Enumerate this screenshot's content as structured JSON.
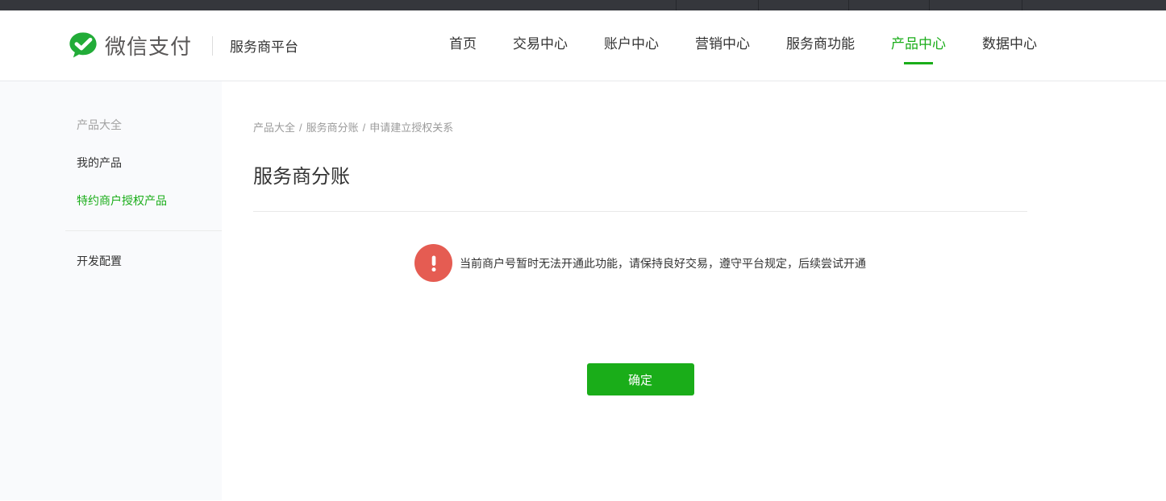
{
  "brand": {
    "name": "微信支付",
    "portal": "服务商平台",
    "logo_icon": "wechat-bubble-check"
  },
  "nav": {
    "items": [
      {
        "label": "首页",
        "active": false
      },
      {
        "label": "交易中心",
        "active": false
      },
      {
        "label": "账户中心",
        "active": false
      },
      {
        "label": "营销中心",
        "active": false
      },
      {
        "label": "服务商功能",
        "active": false
      },
      {
        "label": "产品中心",
        "active": true
      },
      {
        "label": "数据中心",
        "active": false
      }
    ]
  },
  "sidebar": {
    "section_title": "产品大全",
    "items": [
      {
        "label": "我的产品",
        "active": false
      },
      {
        "label": "特约商户授权产品",
        "active": true
      }
    ],
    "bottom_items": [
      {
        "label": "开发配置",
        "active": false
      }
    ]
  },
  "main": {
    "breadcrumb": {
      "segments": [
        "产品大全",
        "服务商分账",
        "申请建立授权关系"
      ],
      "separator": "/"
    },
    "title": "服务商分账",
    "alert": {
      "icon": "exclamation-circle",
      "message": "当前商户号暂时无法开通此功能，请保持良好交易，遵守平台规定，后续尝试开通"
    },
    "confirm_button_label": "确定"
  },
  "colors": {
    "accent_green": "#1aad19",
    "logo_green": "#22ac38",
    "alert_red": "#e55c52",
    "topbar_dark": "#35373c",
    "sidebar_bg": "#f9fafc"
  }
}
